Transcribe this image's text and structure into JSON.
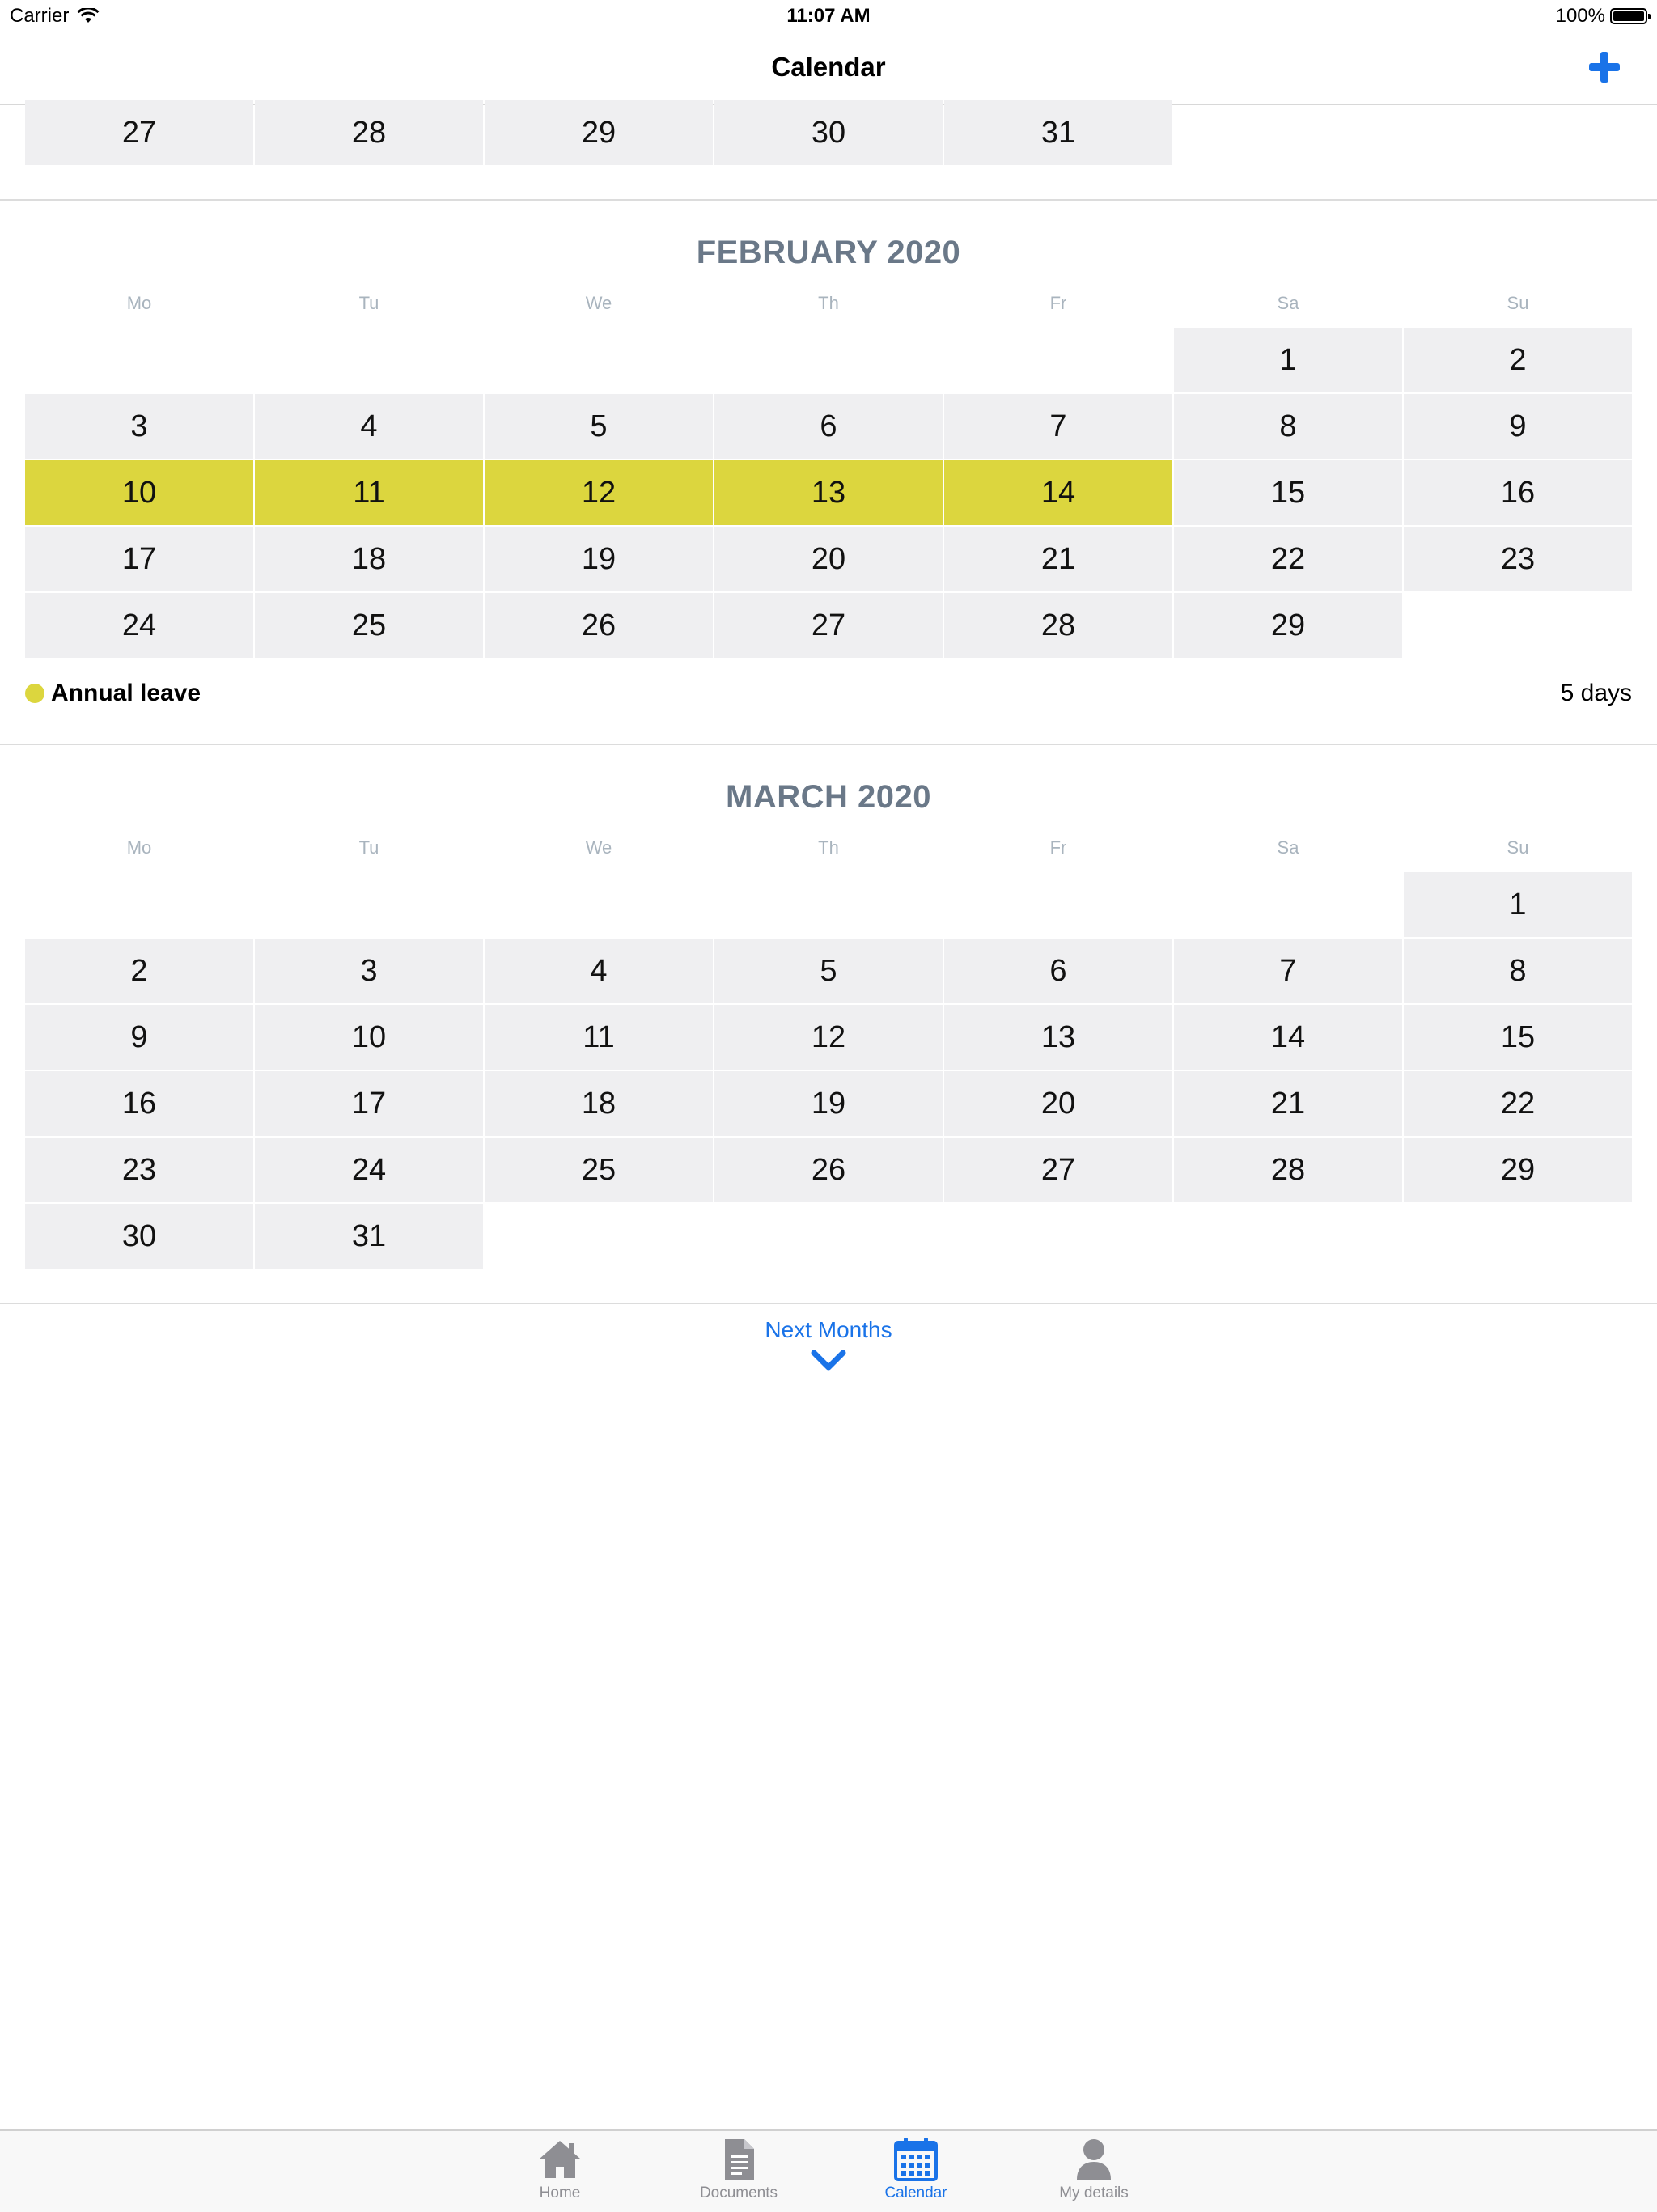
{
  "status_bar": {
    "carrier": "Carrier",
    "time": "11:07 AM",
    "battery": "100%"
  },
  "nav": {
    "title": "Calendar"
  },
  "january_partial": {
    "days": [
      "27",
      "28",
      "29",
      "30",
      "31"
    ]
  },
  "february": {
    "title": "FEBRUARY 2020",
    "weekdays": [
      "Mo",
      "Tu",
      "We",
      "Th",
      "Fr",
      "Sa",
      "Su"
    ],
    "days": [
      "1",
      "2",
      "3",
      "4",
      "5",
      "6",
      "7",
      "8",
      "9",
      "10",
      "11",
      "12",
      "13",
      "14",
      "15",
      "16",
      "17",
      "18",
      "19",
      "20",
      "21",
      "22",
      "23",
      "24",
      "25",
      "26",
      "27",
      "28",
      "29"
    ],
    "highlighted_days": [
      "10",
      "11",
      "12",
      "13",
      "14"
    ],
    "legend": {
      "label": "Annual leave",
      "count": "5 days",
      "color": "#dcd63e"
    }
  },
  "march": {
    "title": "MARCH 2020",
    "weekdays": [
      "Mo",
      "Tu",
      "We",
      "Th",
      "Fr",
      "Sa",
      "Su"
    ],
    "days": [
      "1",
      "2",
      "3",
      "4",
      "5",
      "6",
      "7",
      "8",
      "9",
      "10",
      "11",
      "12",
      "13",
      "14",
      "15",
      "16",
      "17",
      "18",
      "19",
      "20",
      "21",
      "22",
      "23",
      "24",
      "25",
      "26",
      "27",
      "28",
      "29",
      "30",
      "31"
    ]
  },
  "next_months": {
    "label": "Next Months"
  },
  "tab_bar": {
    "tabs": [
      {
        "label": "Home",
        "icon": "home-icon",
        "active": false
      },
      {
        "label": "Documents",
        "icon": "document-icon",
        "active": false
      },
      {
        "label": "Calendar",
        "icon": "calendar-icon",
        "active": true
      },
      {
        "label": "My details",
        "icon": "person-icon",
        "active": false
      }
    ]
  },
  "colors": {
    "accent": "#1a73e8",
    "leave": "#dcd63e",
    "cell": "#efeff1",
    "month_title": "#6a7888"
  }
}
